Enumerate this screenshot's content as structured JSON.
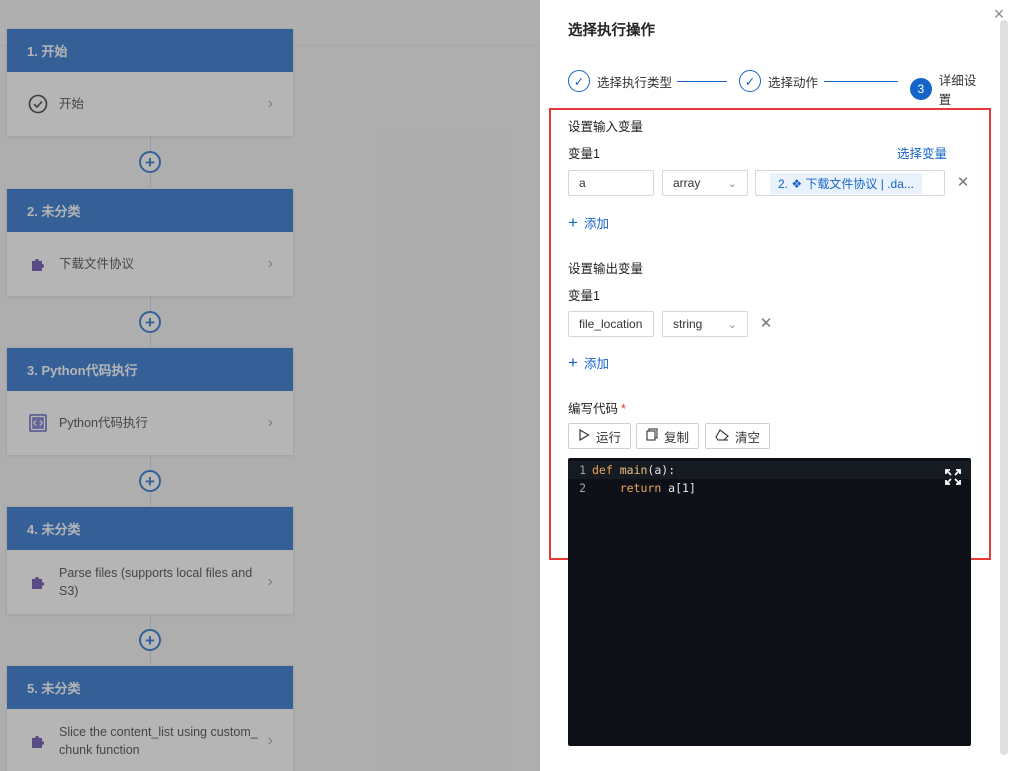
{
  "workflow": {
    "cards": [
      {
        "title": "1. 开始",
        "body": "开始",
        "icon": "check-circle-icon"
      },
      {
        "title": "2. 未分类",
        "body": "下载文件协议",
        "icon": "puzzle-icon"
      },
      {
        "title": "3. Python代码执行",
        "body": "Python代码执行",
        "icon": "code-icon"
      },
      {
        "title": "4. 未分类",
        "body": "Parse files (supports local files and S3)",
        "icon": "puzzle-icon"
      },
      {
        "title": "5. 未分类",
        "body": "Slice the content_list using custom_ chunk function",
        "icon": "puzzle-icon"
      }
    ],
    "plus_label": "+",
    "chevron": "›"
  },
  "drawer": {
    "title": "选择执行操作",
    "close": "×",
    "steps": [
      {
        "label": "选择执行类型",
        "status": "done",
        "mark": "✓"
      },
      {
        "label": "选择动作",
        "status": "done",
        "mark": "✓"
      },
      {
        "label": "详细设置",
        "status": "active",
        "mark": "3"
      }
    ],
    "input_section": {
      "title": "设置输入变量",
      "var_label": "变量1",
      "select_var_link": "选择变量",
      "name_value": "a",
      "type_value": "array",
      "tag_value": "2. ❖ 下载文件协议 | .da...",
      "add_label": "添加"
    },
    "output_section": {
      "title": "设置输出变量",
      "var_label": "变量1",
      "name_value": "file_location",
      "type_value": "string",
      "add_label": "添加"
    },
    "code_section": {
      "title": "编写代码",
      "required": "*",
      "buttons": {
        "run": "运行",
        "copy": "复制",
        "clear": "清空"
      },
      "lines": [
        {
          "no": "1"
        },
        {
          "no": "2"
        }
      ],
      "tokens": {
        "def": "def",
        "fn": "main",
        "sig": "(a):",
        "indent": "    ",
        "ret": "return",
        "expr": " a[1]"
      }
    }
  },
  "colors": {
    "primary": "#1565c9",
    "highlight": "#e53935",
    "editor_bg": "#0d1117"
  }
}
